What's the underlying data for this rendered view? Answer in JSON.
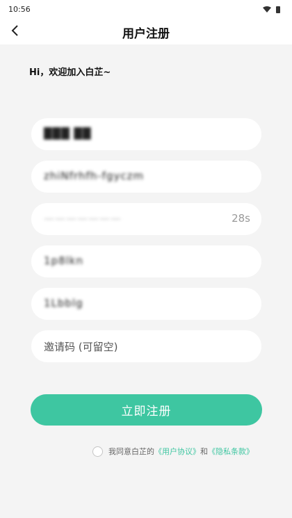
{
  "status_bar": {
    "time": "10:56"
  },
  "header": {
    "title": "用户注册"
  },
  "greeting": "Hi，欢迎加入白芷~",
  "form": {
    "field1_value": "███  ██",
    "field2_value": "zhiNfrhfh-fgyczm",
    "field3_value": "———————",
    "countdown": "28s",
    "field4_value": "1p8lkn",
    "field5_value": "1Lbblg",
    "invite_placeholder": "邀请码 (可留空)"
  },
  "submit_label": "立即注册",
  "agreement": {
    "prefix": "我同意白芷的",
    "user_agreement": "《用户协议》",
    "and": "和",
    "privacy_terms": "《隐私条款》"
  },
  "colors": {
    "accent": "#3ec6a1",
    "background": "#f4f4f4"
  }
}
